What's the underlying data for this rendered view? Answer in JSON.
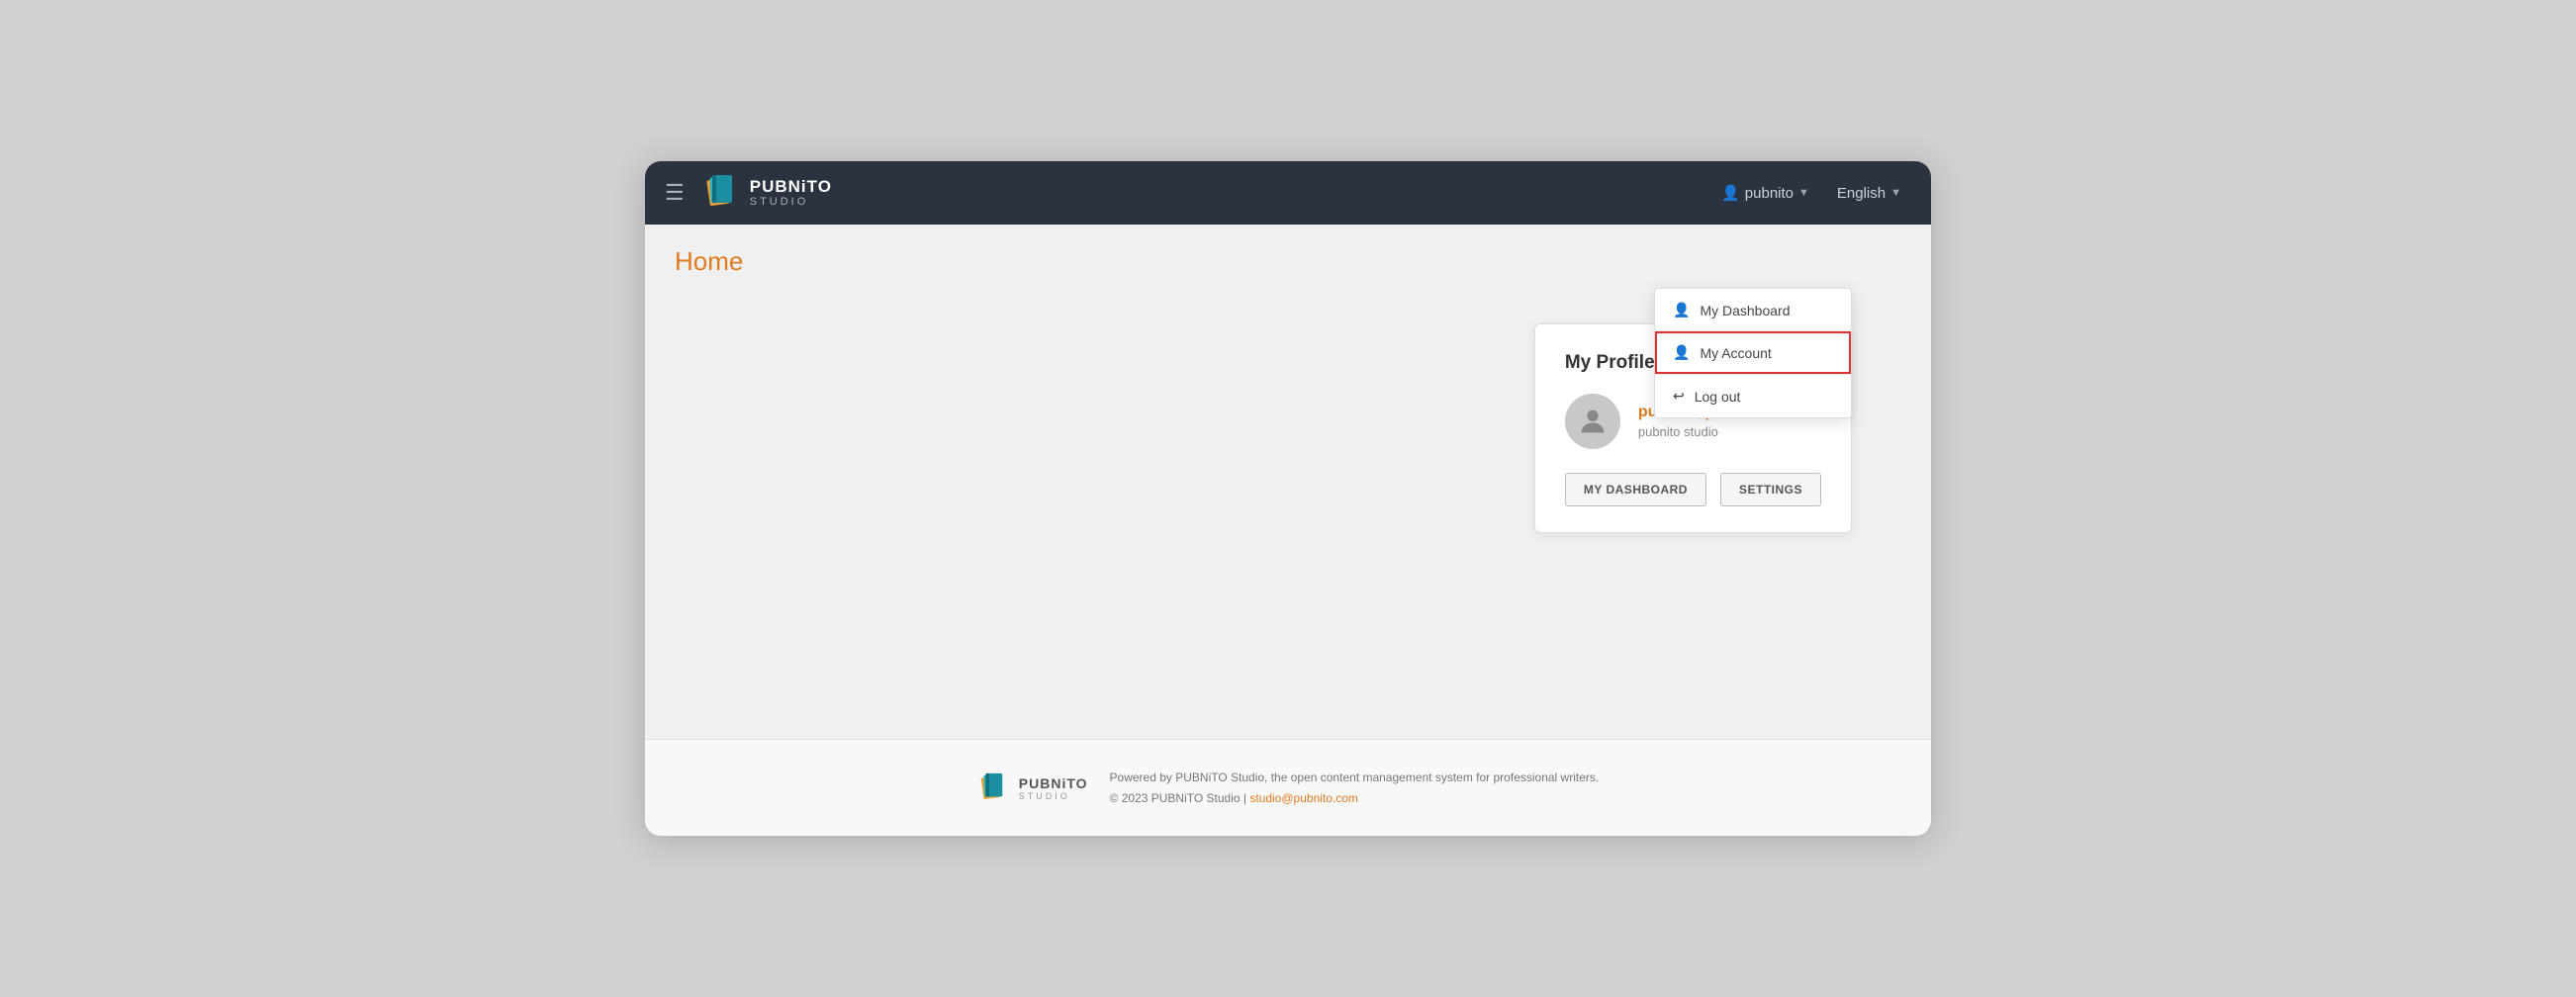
{
  "navbar": {
    "logo_top": "PUBNiTO",
    "logo_bottom": "STUDIO",
    "user_label": "pubnito",
    "language_label": "English"
  },
  "page": {
    "title": "Home"
  },
  "dropdown": {
    "dashboard_label": "My Dashboard",
    "account_label": "My Account",
    "logout_label": "Log out"
  },
  "profile_card": {
    "title": "My Profile",
    "username": "pubnito_pubnito",
    "studio": "pubnito studio",
    "dashboard_btn": "MY DASHBOARD",
    "settings_btn": "SETTINGS"
  },
  "footer": {
    "logo_top": "PUBNiTO",
    "logo_bottom": "STUDIO",
    "powered_text": "Powered by PUBNiTO Studio, the open content management system for professional writers.",
    "copyright": "© 2023 PUBNiTO Studio |",
    "email": "studio@pubnito.com"
  }
}
